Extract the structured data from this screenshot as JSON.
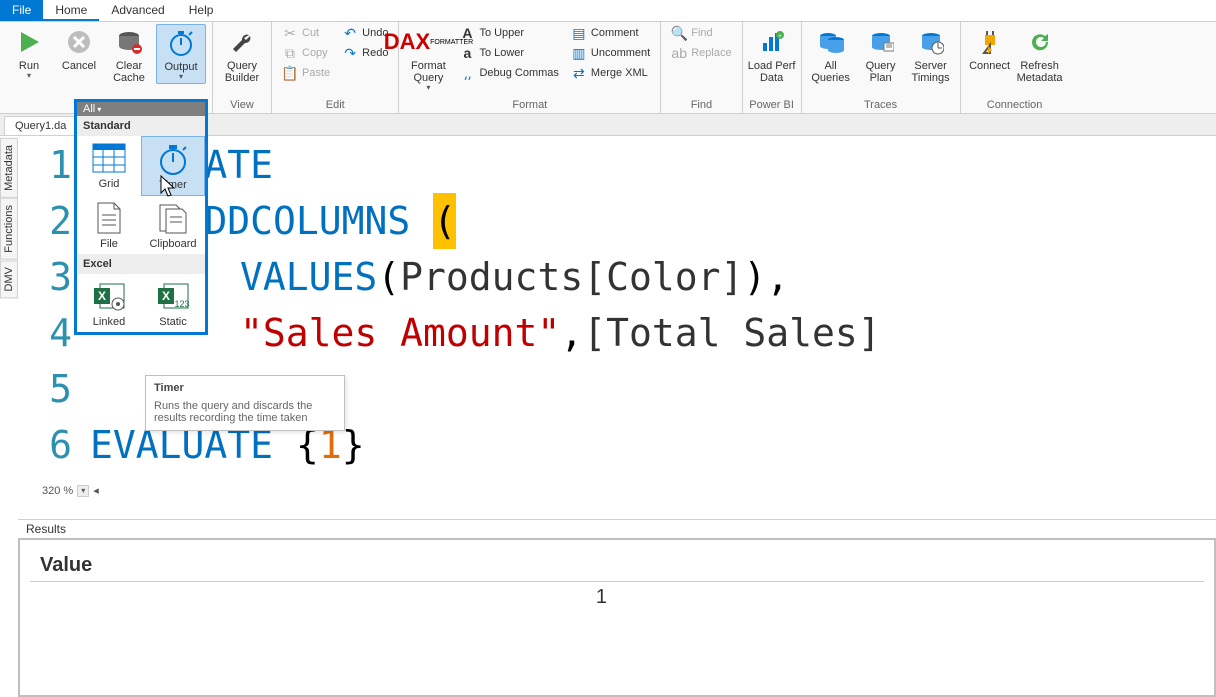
{
  "menu": {
    "file": "File",
    "home": "Home",
    "advanced": "Advanced",
    "help": "Help"
  },
  "ribbon": {
    "run": "Run",
    "cancel": "Cancel",
    "clear_cache": "Clear\nCache",
    "output": "Output",
    "query_builder": "Query\nBuilder",
    "view_group": "View",
    "cut": "Cut",
    "copy": "Copy",
    "paste": "Paste",
    "undo": "Undo",
    "redo": "Redo",
    "edit_group": "Edit",
    "format_query": "Format\nQuery",
    "to_upper": "To Upper",
    "to_lower": "To Lower",
    "debug_commas": "Debug Commas",
    "comment": "Comment",
    "uncomment": "Uncomment",
    "merge_xml": "Merge XML",
    "format_group": "Format",
    "find": "Find",
    "replace": "Replace",
    "find_group": "Find",
    "load_perf_data": "Load Perf\nData",
    "powerbi_group": "Power BI",
    "all_queries": "All\nQueries",
    "query_plan": "Query\nPlan",
    "server_timings": "Server\nTimings",
    "traces_group": "Traces",
    "connect": "Connect",
    "refresh_metadata": "Refresh\nMetadata",
    "connection_group": "Connection"
  },
  "doc_tab": "Query1.da",
  "side_tabs": {
    "metadata": "Metadata",
    "functions": "Functions",
    "dmv": "DMV"
  },
  "output_popup": {
    "all": "All",
    "standard": "Standard",
    "excel": "Excel",
    "grid": "Grid",
    "timer": "Timer",
    "file": "File",
    "clipboard": "Clipboard",
    "linked": "Linked",
    "static": "Static"
  },
  "tooltip": {
    "title": "Timer",
    "body": "Runs the query and discards the results recording the time taken"
  },
  "code": {
    "l1_kw": "EVALUATE",
    "l1_visible": "UATE",
    "l2_func": "ADDCOLUMNS",
    "l3_func": "VALUES",
    "l3_ident": "Products[Color]",
    "l4_str": "\"Sales Amount\"",
    "l4_ident": "[Total Sales]",
    "l6_kw": "EVALUATE",
    "l6_num": "1"
  },
  "zoom": "320 %",
  "results": {
    "tab": "Results",
    "header": "Value",
    "row1": "1"
  }
}
